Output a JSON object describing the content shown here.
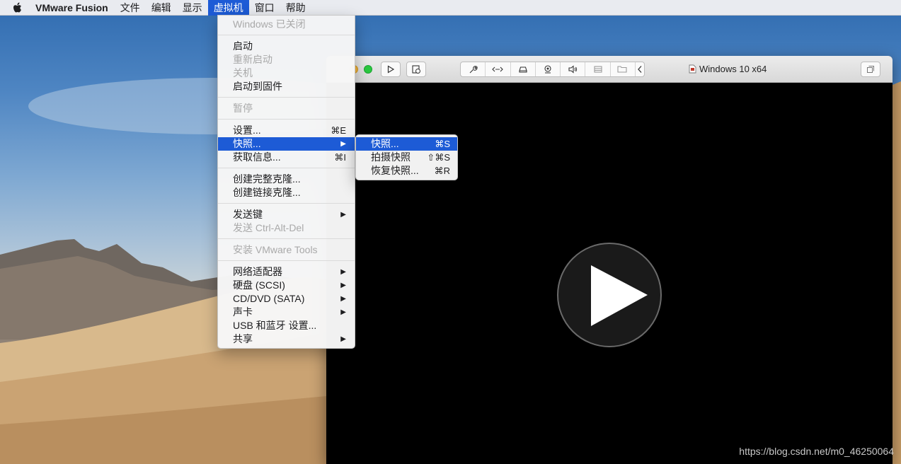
{
  "menubar": {
    "app_name": "VMware Fusion",
    "items": [
      "文件",
      "编辑",
      "显示",
      "虚拟机",
      "窗口",
      "帮助"
    ],
    "active_index": 3
  },
  "vm_menu": {
    "status": "Windows 已关闭",
    "start": "启动",
    "restart": "重新启动",
    "shutdown": "关机",
    "boot_firmware": "启动到固件",
    "pause": "暂停",
    "settings": {
      "label": "设置...",
      "shortcut": "⌘E"
    },
    "snapshots": {
      "label": "快照..."
    },
    "get_info": {
      "label": "获取信息...",
      "shortcut": "⌘I"
    },
    "full_clone": "创建完整克隆...",
    "linked_clone": "创建链接克隆...",
    "send_key": "发送键",
    "send_ctrl_alt_del": "发送 Ctrl-Alt-Del",
    "install_tools": "安装 VMware Tools",
    "network_adapter": "网络适配器",
    "hard_disk": "硬盘 (SCSI)",
    "cd_dvd": "CD/DVD (SATA)",
    "sound_card": "声卡",
    "usb_bluetooth": "USB 和蓝牙 设置...",
    "sharing": "共享"
  },
  "snapshot_submenu": {
    "snapshots": {
      "label": "快照...",
      "shortcut": "⌘S"
    },
    "take_snapshot": {
      "label": "拍摄快照",
      "shortcut": "⇧⌘S"
    },
    "restore_snapshot": {
      "label": "恢复快照...",
      "shortcut": "⌘R"
    }
  },
  "vm_window": {
    "title": "Windows 10 x64"
  },
  "watermark": "https://blog.csdn.net/m0_46250064",
  "colors": {
    "highlight": "#1d5bd6",
    "disabled_text": "#a9a9a9",
    "menu_bg": "#f6f6f6",
    "vm_screen": "#000000"
  },
  "icons": [
    "apple-icon",
    "play-icon",
    "snapshot-icon",
    "wrench-icon",
    "code-icon",
    "drive-icon",
    "camera-icon",
    "speaker-icon",
    "printer-icon",
    "folder-icon",
    "back-chevron-icon",
    "fullscreen-icon",
    "vm-document-icon",
    "large-play-icon",
    "submenu-arrow-icon"
  ]
}
